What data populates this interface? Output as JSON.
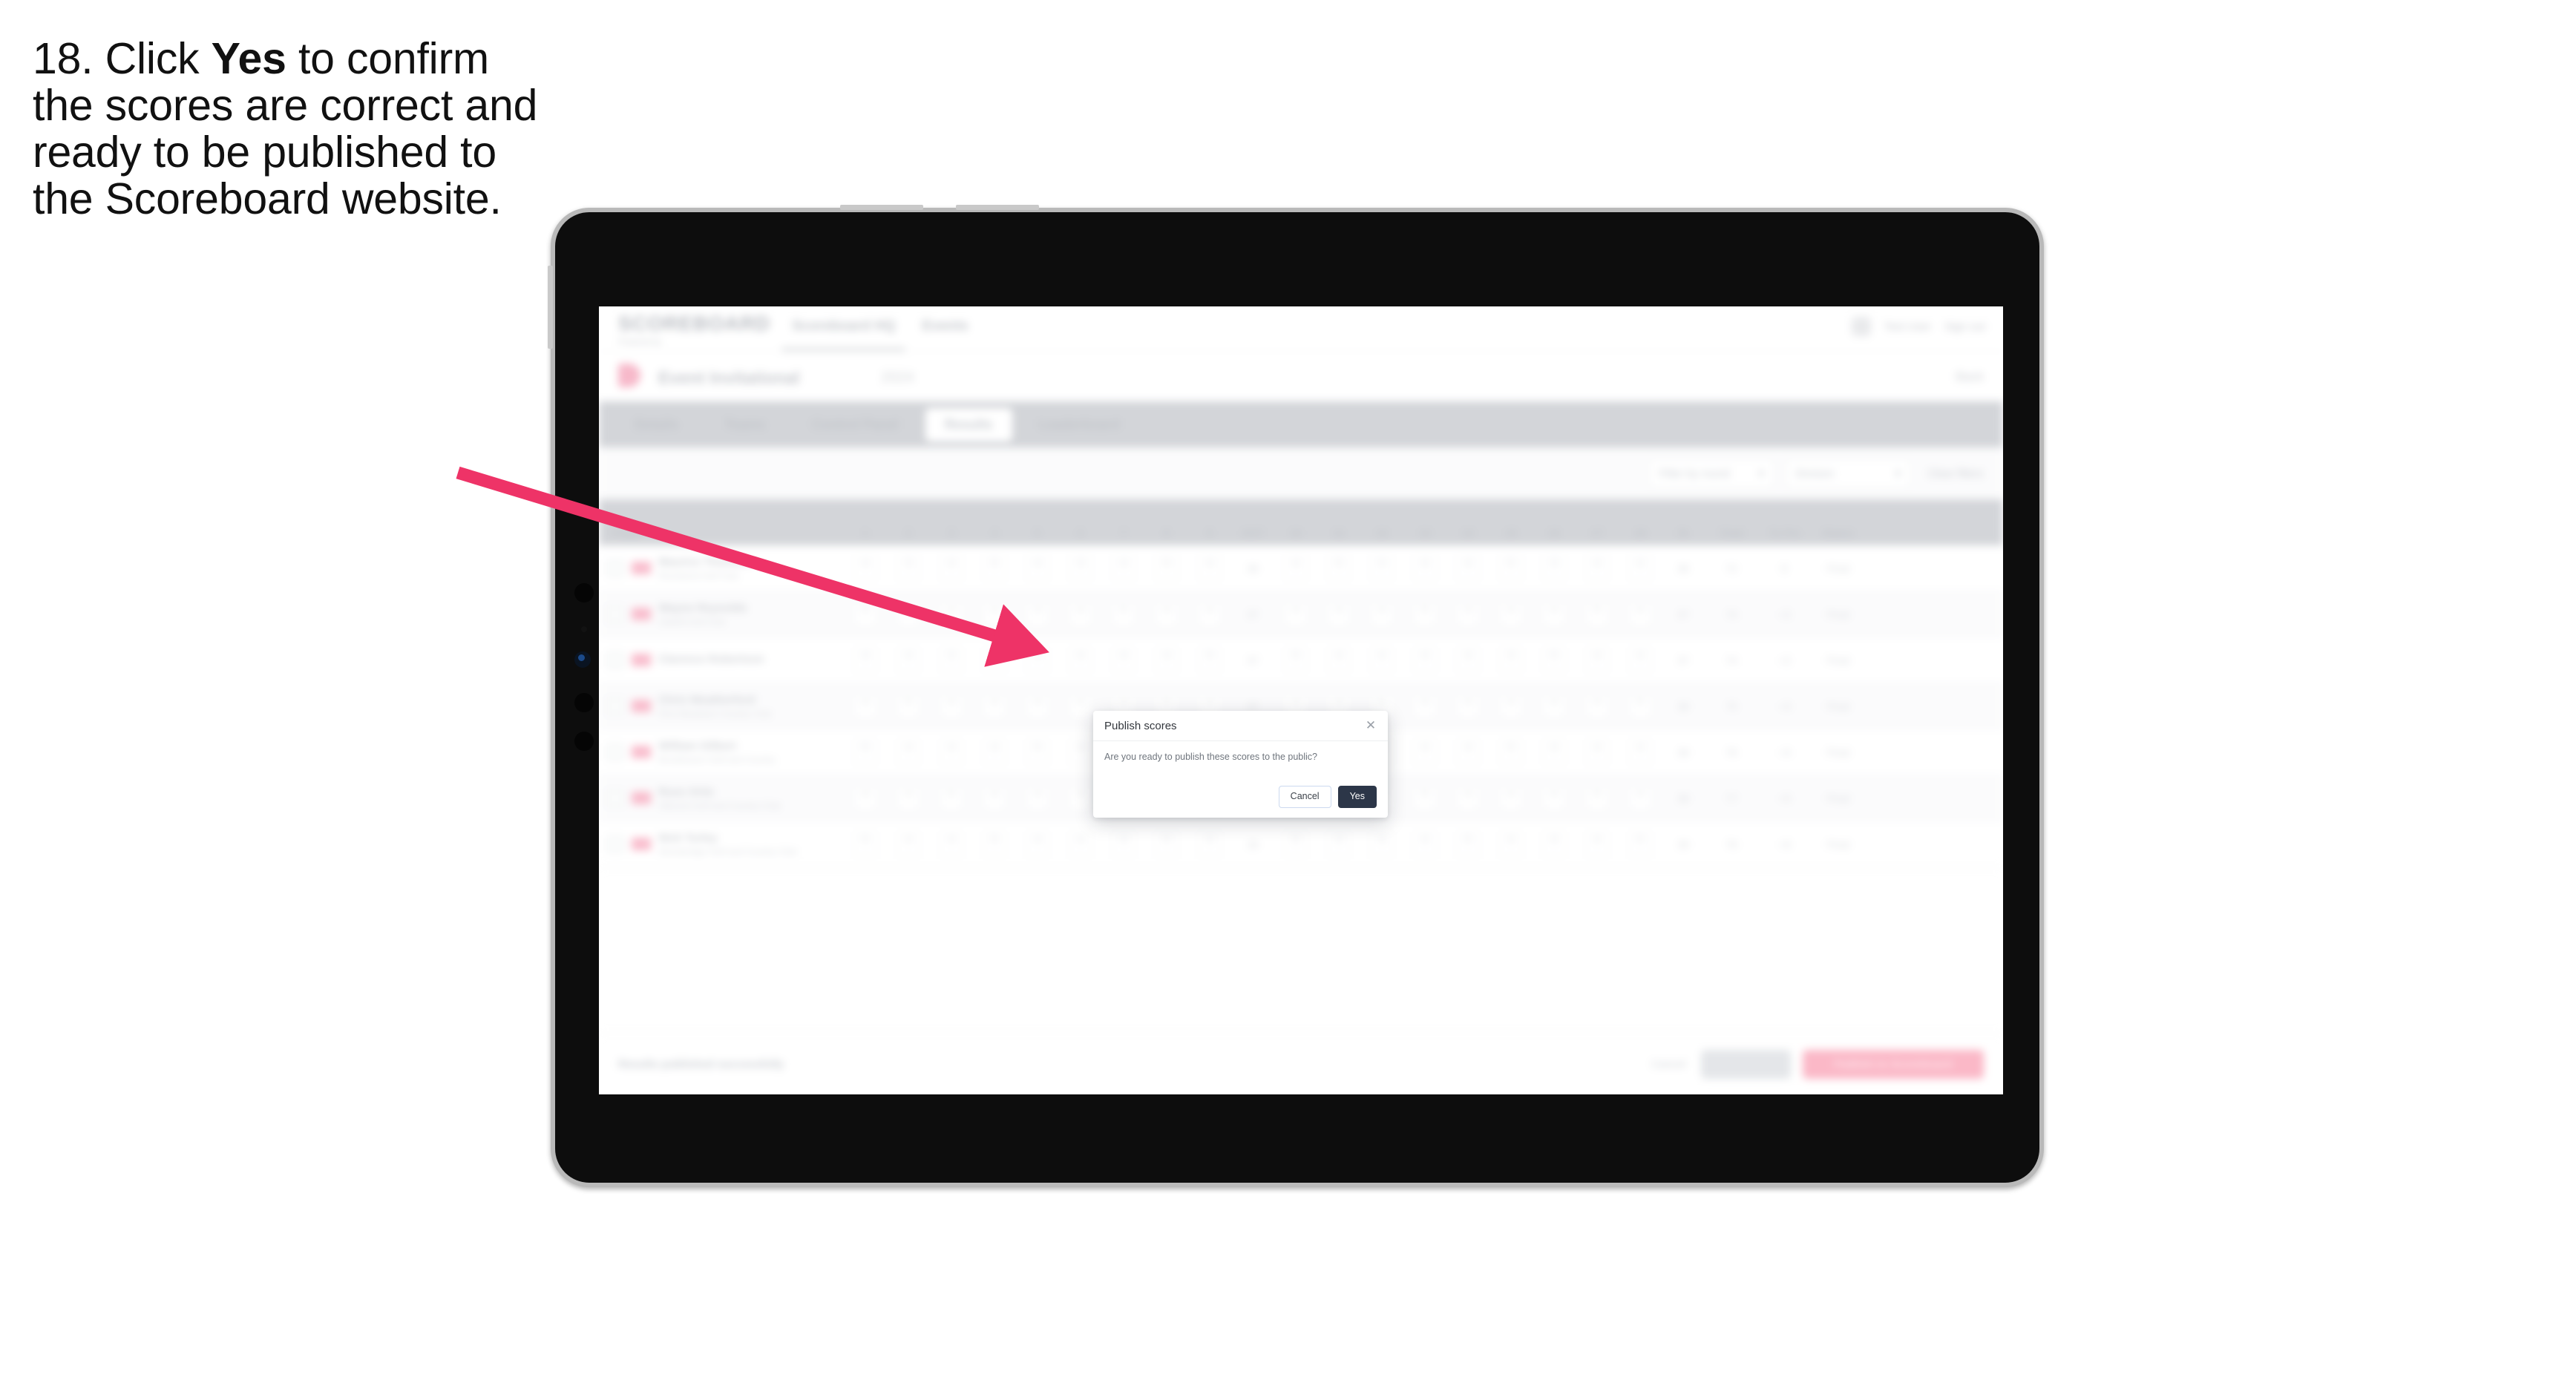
{
  "instruction": {
    "prefix": "18. Click ",
    "bold": "Yes",
    "suffix": " to confirm the scores are correct and ready to be published to the Scoreboard website."
  },
  "colors": {
    "arrow": "#ee3367",
    "primary_button": "#2c3648",
    "accent_pink": "#f04a7b",
    "device_bezel": "#b9b9b9",
    "device_body": "#0d0d0d"
  },
  "app": {
    "logo": {
      "main": "SCOREBOARD",
      "sub": "Powered by",
      "badge": ""
    },
    "nav_tabs": [
      {
        "label": "Scoreboard HQ",
        "active": true
      },
      {
        "label": "Events",
        "active": false
      }
    ],
    "header_right": {
      "user": "Test User",
      "signout": "Sign out"
    },
    "event": {
      "title": "Event Invitational",
      "year": "2024",
      "right_link": "Back"
    },
    "sub_tabs": [
      {
        "label": "Details",
        "active": false
      },
      {
        "label": "Teams",
        "active": false
      },
      {
        "label": "Control Panel",
        "active": false
      },
      {
        "label": "Results",
        "active": true
      },
      {
        "label": "Leaderboard",
        "active": false
      }
    ],
    "filters": {
      "search_placeholder": "Search",
      "select_one": "Filter by round",
      "select_two": "Division",
      "link": "Clear filters"
    },
    "table": {
      "columns": [
        "Player",
        "1",
        "2",
        "3",
        "4",
        "5",
        "6",
        "7",
        "8",
        "9",
        "OUT",
        "10",
        "11",
        "12",
        "13",
        "14",
        "15",
        "16",
        "17",
        "18",
        "IN",
        "Total",
        "To Par",
        "Status"
      ],
      "rows": [
        {
          "name": "Maurice Thomson",
          "club": "Riverbend Golf Club",
          "scores": [
            "4",
            "3",
            "4",
            "5",
            "4",
            "3",
            "4",
            "5",
            "4"
          ],
          "out": "36",
          "scores_in": [
            "4",
            "5",
            "3",
            "4",
            "4",
            "5",
            "3",
            "4",
            "4"
          ],
          "in": "36",
          "total": "72",
          "topar": "E",
          "status": "Final"
        },
        {
          "name": "Wayne Reynolds",
          "club": "Oakhill Golf Club",
          "scores": [
            "5",
            "4",
            "4",
            "4",
            "3",
            "4",
            "5",
            "4",
            "4"
          ],
          "out": "37",
          "scores_in": [
            "4",
            "4",
            "4",
            "5",
            "3",
            "4",
            "4",
            "5",
            "4"
          ],
          "in": "37",
          "total": "74",
          "topar": "+2",
          "status": "Final"
        },
        {
          "name": "Clarence Robertson",
          "club": "",
          "scores": [
            "4",
            "4",
            "3",
            "5",
            "4",
            "4",
            "4",
            "4",
            "5"
          ],
          "out": "37",
          "scores_in": [
            "5",
            "4",
            "4",
            "4",
            "4",
            "3",
            "5",
            "4",
            "4"
          ],
          "in": "37",
          "total": "74",
          "topar": "+2",
          "status": "Final"
        },
        {
          "name": "Chris Weatherford",
          "club": "Pine Meadows Country Club",
          "scores": [
            "4",
            "5",
            "4",
            "4",
            "4",
            "4",
            "3",
            "5",
            "4"
          ],
          "out": "37",
          "scores_in": [
            "4",
            "4",
            "5",
            "4",
            "4",
            "4",
            "4",
            "4",
            "5"
          ],
          "in": "38",
          "total": "75",
          "topar": "+3",
          "status": "Final"
        },
        {
          "name": "William Gilbert",
          "club": "Brookhaven Golf and Country",
          "scores": [
            "5",
            "4",
            "4",
            "4",
            "5",
            "4",
            "4",
            "4",
            "4"
          ],
          "out": "38",
          "scores_in": [
            "4",
            "5",
            "4",
            "4",
            "4",
            "5",
            "4",
            "4",
            "4"
          ],
          "in": "38",
          "total": "76",
          "topar": "+4",
          "status": "Final"
        },
        {
          "name": "Russ Ortiz",
          "club": "Hillcrest Golf and Country Club",
          "scores": [
            "4",
            "4",
            "5",
            "4",
            "4",
            "4",
            "5",
            "4",
            "5"
          ],
          "out": "39",
          "scores_in": [
            "4",
            "4",
            "4",
            "5",
            "4",
            "4",
            "4",
            "5",
            "4"
          ],
          "in": "38",
          "total": "77",
          "topar": "+5",
          "status": "Final"
        },
        {
          "name": "Nick Turley",
          "club": "Stonebridge Golf and Country Club",
          "scores": [
            "5",
            "4",
            "4",
            "5",
            "4",
            "4",
            "4",
            "5",
            "4"
          ],
          "out": "39",
          "scores_in": [
            "5",
            "4",
            "4",
            "4",
            "5",
            "4",
            "4",
            "4",
            "5"
          ],
          "in": "39",
          "total": "78",
          "topar": "+6",
          "status": "Final"
        }
      ]
    },
    "footer": {
      "note": "Results published successfully",
      "link": "Cancel",
      "btn_grey": "Save all",
      "btn_pink": "Publish to Scoreboard"
    }
  },
  "modal": {
    "title": "Publish scores",
    "message": "Are you ready to publish these scores to the public?",
    "close_icon": "✕",
    "cancel_label": "Cancel",
    "yes_label": "Yes"
  }
}
